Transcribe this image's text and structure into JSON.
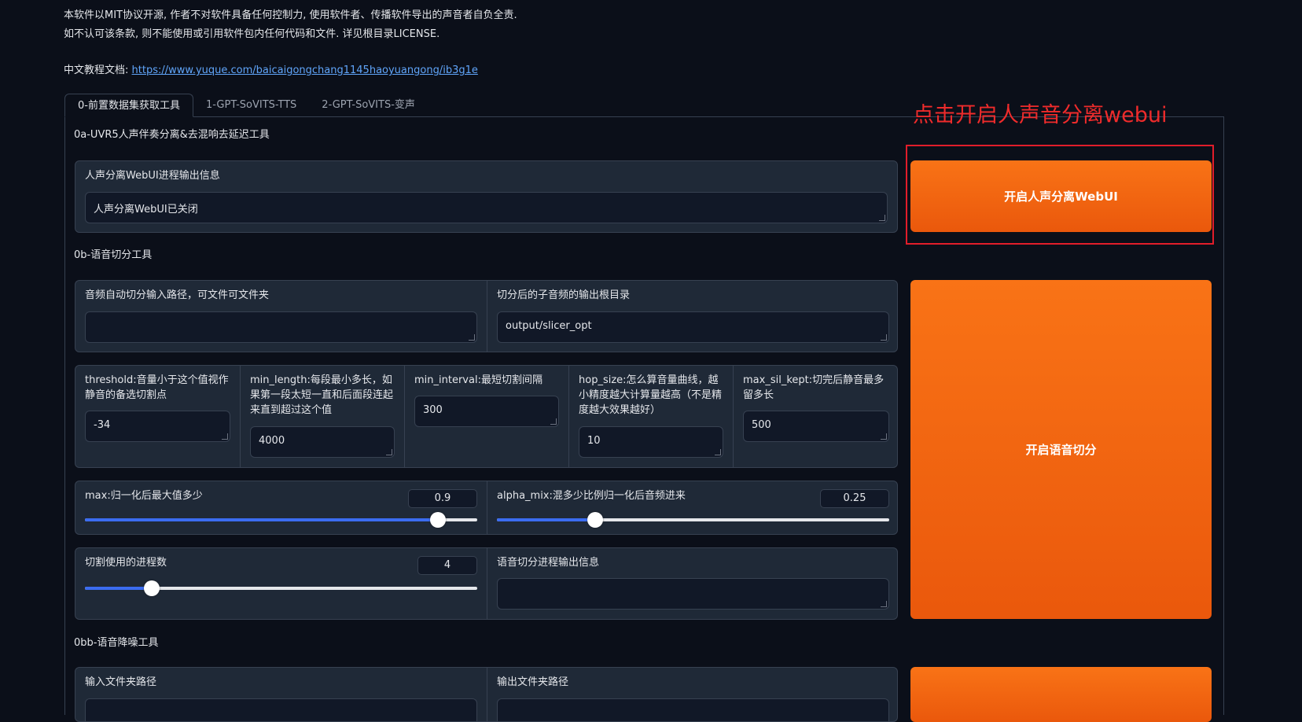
{
  "intro": {
    "line1": "本软件以MIT协议开源, 作者不对软件具备任何控制力, 使用软件者、传播软件导出的声音者自负全责.",
    "line2": "如不认可该条款, 则不能使用或引用软件包内任何代码和文件. 详见根目录LICENSE.",
    "doc_label": "中文教程文档: ",
    "doc_link": "https://www.yuque.com/baicaigongchang1145haoyuangong/ib3g1e"
  },
  "tabs": [
    "0-前置数据集获取工具",
    "1-GPT-SoVITS-TTS",
    "2-GPT-SoVITS-变声"
  ],
  "annotation": "点击开启人声音分离webui",
  "uvr": {
    "title": "0a-UVR5人声伴奏分离&去混响去延迟工具",
    "info_label": "人声分离WebUI进程输出信息",
    "info_value": "人声分离WebUI已关闭",
    "button": "开启人声分离WebUI"
  },
  "slicer": {
    "title": "0b-语音切分工具",
    "input_label": "音频自动切分输入路径，可文件可文件夹",
    "input_value": "",
    "output_label": "切分后的子音频的输出根目录",
    "output_value": "output/slicer_opt",
    "threshold_label": "threshold:音量小于这个值视作静音的备选切割点",
    "threshold_value": "-34",
    "min_length_label": "min_length:每段最小多长，如果第一段太短一直和后面段连起来直到超过这个值",
    "min_length_value": "4000",
    "min_interval_label": "min_interval:最短切割间隔",
    "min_interval_value": "300",
    "hop_size_label": "hop_size:怎么算音量曲线，越小精度越大计算量越高（不是精度越大效果越好）",
    "hop_size_value": "10",
    "max_sil_label": "max_sil_kept:切完后静音最多留多长",
    "max_sil_value": "500",
    "max_label": "max:归一化后最大值多少",
    "max_value": "0.9",
    "alpha_label": "alpha_mix:混多少比例归一化后音频进来",
    "alpha_value": "0.25",
    "procs_label": "切割使用的进程数",
    "procs_value": "4",
    "output_info_label": "语音切分进程输出信息",
    "output_info_value": "",
    "button": "开启语音切分"
  },
  "denoise": {
    "title": "0bb-语音降噪工具",
    "input_label": "输入文件夹路径",
    "output_label": "输出文件夹路径"
  },
  "sliders": {
    "max_fraction": 0.9,
    "alpha_fraction": 0.25,
    "procs_fraction": 0.17
  },
  "colors": {
    "accent_orange": "#f97316",
    "slider_blue": "#3b6cf0",
    "annotation_red": "#ef2b2b",
    "background": "#0b0f19"
  }
}
